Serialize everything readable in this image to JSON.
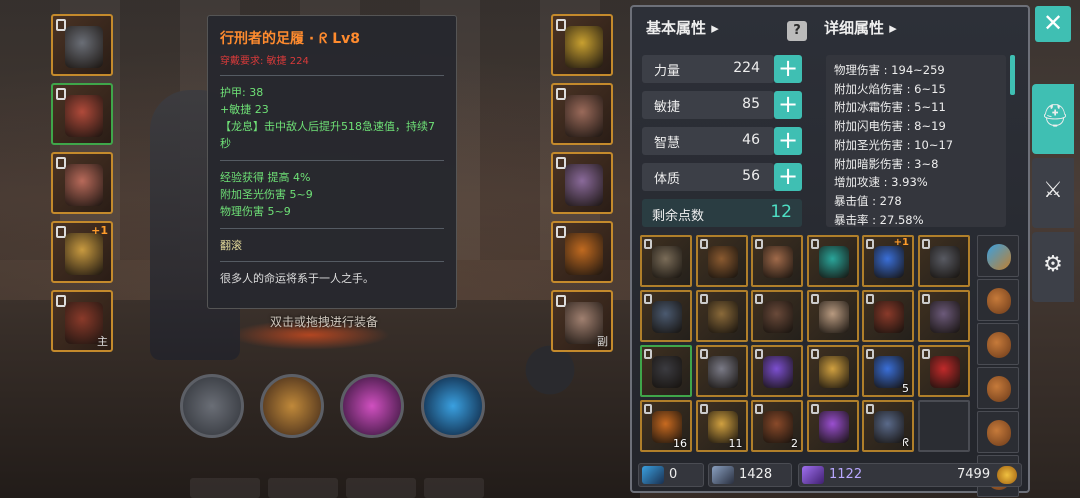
{
  "tooltip": {
    "title": "行刑者的足履 · ᖇ Lv8",
    "requirement": "穿戴要求:  敏捷 224",
    "base_lines": [
      "护甲:  38",
      "+敏捷  23"
    ],
    "skill_line": "【龙息】击中敌人后提升518急速值，持续7秒",
    "bonus_lines": [
      "经验获得  提高 4%",
      "附加圣光伤害  5~9",
      "物理伤害  5~9"
    ],
    "action": "翻滚",
    "flavor": "很多人的命运将系于一人之手。"
  },
  "equip_hint": "双击或拖拽进行装备",
  "left_slots": [
    {
      "name": "helmet-slot",
      "tag": "",
      "plus": ""
    },
    {
      "name": "armor-slot",
      "tag": "",
      "plus": ""
    },
    {
      "name": "pants-slot",
      "tag": "",
      "plus": ""
    },
    {
      "name": "ring-slot",
      "tag": "",
      "plus": "+1"
    },
    {
      "name": "main-weapon-slot",
      "tag": "主",
      "plus": ""
    }
  ],
  "right_slots": [
    {
      "name": "necklace-slot",
      "tag": "",
      "plus": ""
    },
    {
      "name": "gloves-slot",
      "tag": "",
      "plus": ""
    },
    {
      "name": "boots-slot",
      "tag": "",
      "plus": ""
    },
    {
      "name": "ring2-slot",
      "tag": "",
      "plus": ""
    },
    {
      "name": "off-weapon-slot",
      "tag": "副",
      "plus": ""
    }
  ],
  "basic": {
    "title": "基本属性",
    "stats": [
      {
        "name": "力量",
        "value": "224"
      },
      {
        "name": "敏捷",
        "value": "85"
      },
      {
        "name": "智慧",
        "value": "46"
      },
      {
        "name": "体质",
        "value": "56"
      }
    ],
    "remaining_label": "剩余点数",
    "remaining_value": "12",
    "help_glyph": "?"
  },
  "detail": {
    "title": "详细属性",
    "lines": [
      "物理伤害 : 194~259",
      "附加火焰伤害 : 6~15",
      "附加冰霜伤害 : 5~11",
      "附加闪电伤害 : 8~19",
      "附加圣光伤害 : 10~17",
      "附加暗影伤害 : 3~8",
      "增加攻速 : 3.93%",
      "暴击值 : 278",
      "暴击率 : 27.58%"
    ]
  },
  "inventory": [
    {
      "qty": "",
      "plus": "",
      "color": "#7a6c58"
    },
    {
      "qty": "",
      "plus": "",
      "color": "#8a5a30"
    },
    {
      "qty": "",
      "plus": "",
      "color": "#a06a4a"
    },
    {
      "qty": "",
      "plus": "",
      "color": "#2aa59a"
    },
    {
      "qty": "",
      "plus": "+1",
      "color": "#3a6fd8"
    },
    {
      "qty": "",
      "plus": "",
      "color": "#585a62"
    },
    {
      "qty": "",
      "plus": "",
      "color": "#4b5a70"
    },
    {
      "qty": "",
      "plus": "",
      "color": "#8a6a3a"
    },
    {
      "qty": "",
      "plus": "",
      "color": "#6a4a3a"
    },
    {
      "qty": "",
      "plus": "",
      "color": "#b89a80"
    },
    {
      "qty": "",
      "plus": "",
      "color": "#8a3a2a"
    },
    {
      "qty": "",
      "plus": "",
      "color": "#6c5a7a"
    },
    {
      "qty": "",
      "plus": "",
      "color": "#3b3b40",
      "green": true
    },
    {
      "qty": "",
      "plus": "",
      "color": "#7a7a86"
    },
    {
      "qty": "",
      "plus": "",
      "color": "#7c4fd0"
    },
    {
      "qty": "",
      "plus": "",
      "color": "#d0a040"
    },
    {
      "qty": "5",
      "plus": "",
      "color": "#3a6fd8"
    },
    {
      "qty": "",
      "plus": "",
      "color": "#c02a2a"
    },
    {
      "qty": "16",
      "plus": "",
      "color": "#c86a20"
    },
    {
      "qty": "11",
      "plus": "",
      "color": "#d0a040"
    },
    {
      "qty": "2",
      "plus": "",
      "color": "#8a4a2a"
    },
    {
      "qty": "",
      "plus": "",
      "color": "#9a4fd0"
    },
    {
      "qty": "ᖇ",
      "plus": "",
      "color": "#5a6a8a"
    },
    {
      "qty": "",
      "plus": "",
      "color": "",
      "empty": true
    }
  ],
  "bags_count": 6,
  "currency": {
    "crystal": "0",
    "dust": "1428",
    "gem": "1122",
    "gold": "7499"
  },
  "close_glyph": "✕",
  "colors": {
    "accent": "#3fbfb3",
    "orange": "#ff8b2e",
    "green": "#6ee076",
    "red": "#d83a3a"
  }
}
